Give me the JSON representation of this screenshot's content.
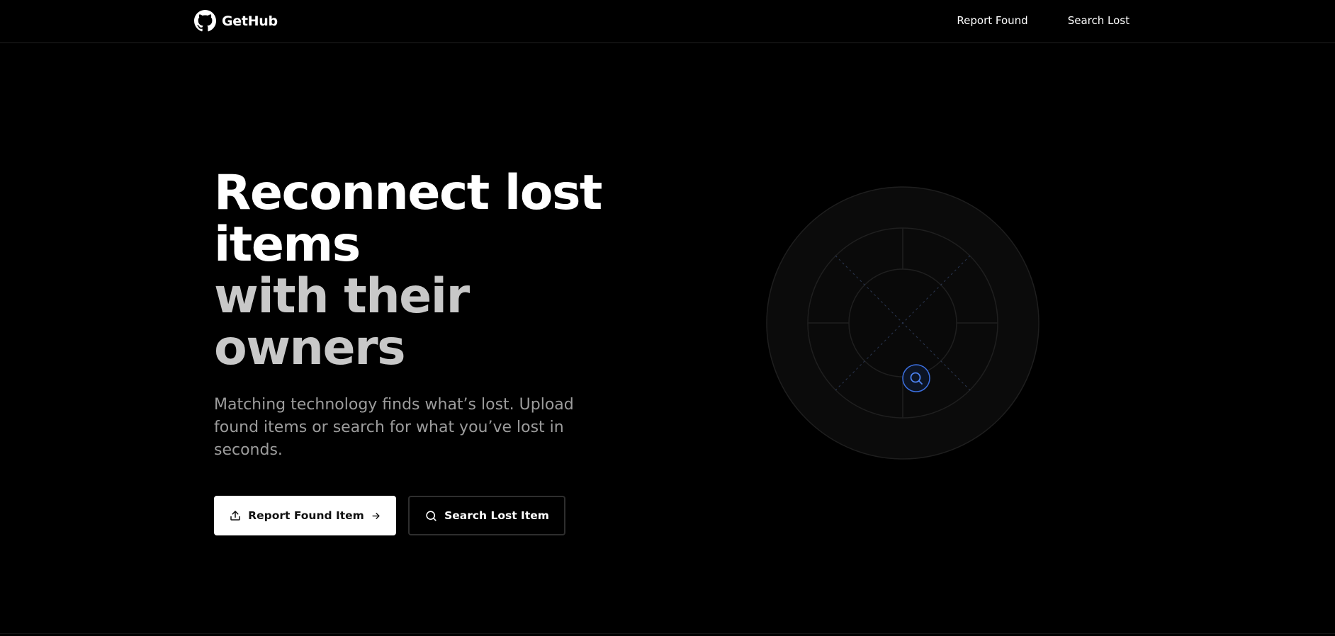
{
  "brand": {
    "name": "GetHub",
    "icon": "github-octocat-icon"
  },
  "nav": {
    "items": [
      {
        "label": "Report Found"
      },
      {
        "label": "Search Lost"
      }
    ]
  },
  "hero": {
    "title_line_1": "Reconnect lost items",
    "title_line_2": "with their owners",
    "subtitle": "Matching technology finds what’s lost. Upload found items or search for what you’ve lost in seconds.",
    "primary_button": {
      "label": "Report Found Item",
      "icon": "upload-icon",
      "trailing_icon": "arrow-right-icon"
    },
    "secondary_button": {
      "label": "Search Lost Item",
      "icon": "search-icon"
    }
  },
  "graphic": {
    "type": "radar",
    "center_icon": "search-icon",
    "accent_color": "#3b6fe0"
  },
  "colors": {
    "background": "#000000",
    "title_primary": "#ffffff",
    "title_secondary": "#c8c8c8",
    "subtitle": "#9c9c9c",
    "primary_button_bg": "#ffffff"
  }
}
